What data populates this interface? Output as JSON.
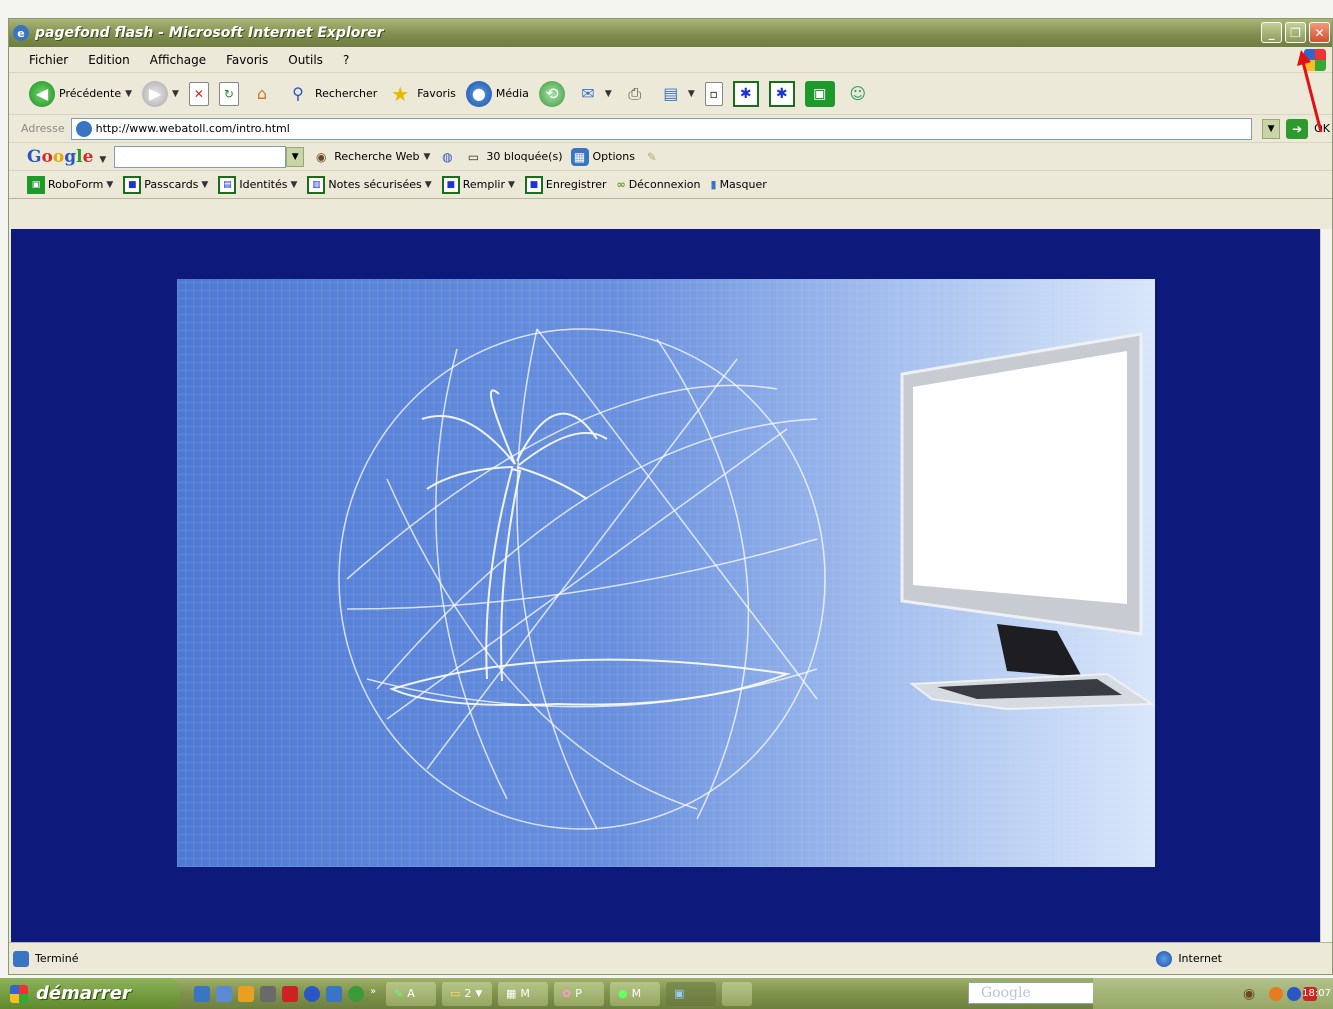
{
  "window": {
    "title": "pagefond flash - Microsoft Internet Explorer"
  },
  "menu": {
    "items": [
      "Fichier",
      "Edition",
      "Affichage",
      "Favoris",
      "Outils",
      "?"
    ]
  },
  "toolbar": {
    "back_label": "Précédente",
    "search_label": "Rechercher",
    "favorites_label": "Favoris",
    "media_label": "Média"
  },
  "address": {
    "label": "Adresse",
    "url": "http://www.webatoll.com/intro.html",
    "go_label": "OK"
  },
  "google": {
    "logo": [
      "G",
      "o",
      "o",
      "g",
      "l",
      "e"
    ],
    "search_web": "Recherche Web",
    "blocked": "30 bloquée(s)",
    "options": "Options"
  },
  "roboform": {
    "items": [
      "RoboForm",
      "Passcards",
      "Identités",
      "Notes sécurisées",
      "Remplir",
      "Enregistrer",
      "Déconnexion",
      "Masquer"
    ]
  },
  "status": {
    "text": "Terminé",
    "zone": "Internet"
  },
  "taskbar": {
    "start_label": "démarrer",
    "tasks": [
      "A",
      "2",
      "M",
      "P",
      "M"
    ],
    "google_box": "Google",
    "clock": "18:07"
  },
  "colors": {
    "title_bar": "#7d8c4c",
    "page_bg": "#0d1a7b",
    "banner_left": "#4e7ad4",
    "banner_right": "#d9e6fa"
  }
}
